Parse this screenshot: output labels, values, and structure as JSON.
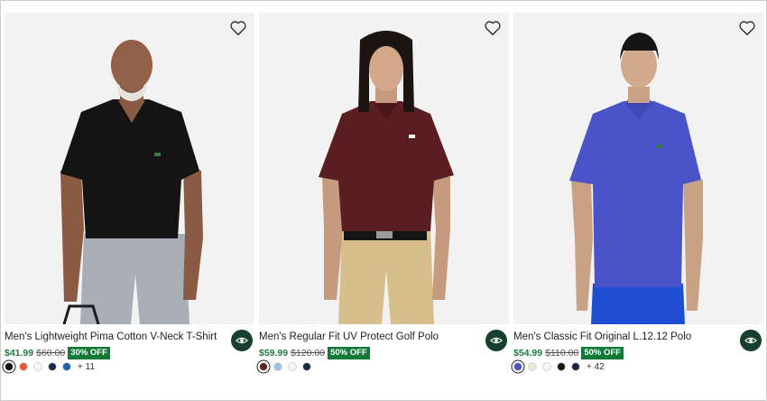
{
  "products": [
    {
      "title": "Men's Lightweight Pima Cotton V-Neck T-Shirt",
      "price": "$41.99",
      "original_price": "$60.00",
      "discount": "30% OFF",
      "image": "man-black-vneck-tshirt-grey-jeans",
      "swatches": [
        "#111111",
        "#e8553a",
        "#f4f4f4",
        "#1c2a45",
        "#1e5fa8"
      ],
      "more_colors": "+ 11"
    },
    {
      "title": "Men's Regular Fit UV Protect Golf Polo",
      "price": "$59.99",
      "original_price": "$120.00",
      "discount": "50% OFF",
      "image": "man-burgundy-golf-polo-khaki-trousers",
      "swatches": [
        "#5a2a22",
        "#9cc3e2",
        "#f2f2f2",
        "#1b2844"
      ],
      "more_colors": ""
    },
    {
      "title": "Men's Classic Fit Original L.12.12 Polo",
      "price": "$54.99",
      "original_price": "$110.00",
      "discount": "50% OFF",
      "image": "man-blue-pique-polo-blue-trousers",
      "swatches": [
        "#4a54c8",
        "#ece8d6",
        "#f4f4f4",
        "#141414",
        "#1b2844"
      ],
      "more_colors": "+ 42"
    }
  ],
  "icons": {
    "wishlist": "heart-outline-icon",
    "quick_view": "eye-icon"
  },
  "colors": {
    "sale_price": "#1f7a3c",
    "discount_badge": "#117a37",
    "quick_view_button": "#16402c"
  }
}
